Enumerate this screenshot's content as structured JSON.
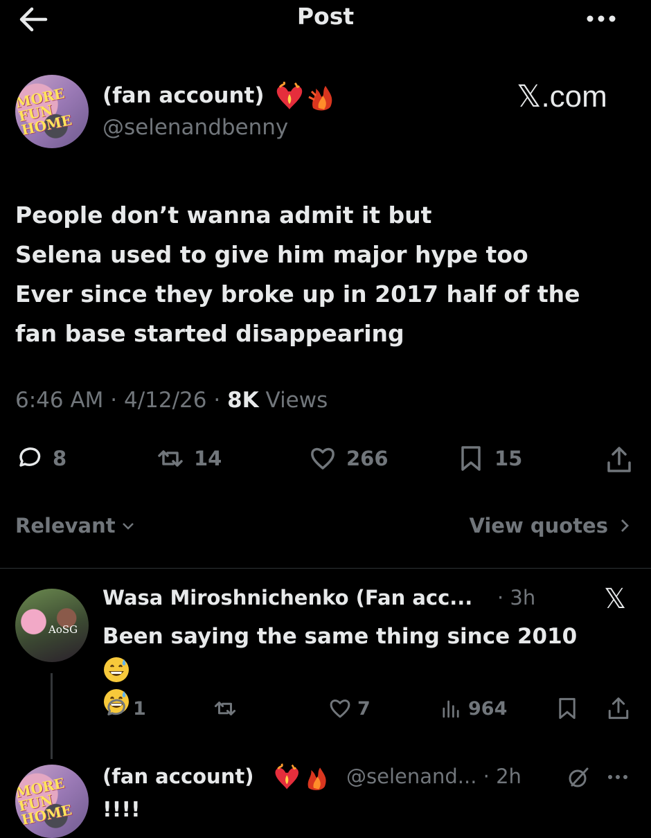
{
  "header": {
    "title": "Post",
    "back_icon": "arrow-left-icon",
    "more_icon": "more-horizontal-icon"
  },
  "post": {
    "author": {
      "display_name": "(fan account)",
      "handle": "@selenandbenny",
      "badge_emojis": "heart-on-fire-icon, fire-icon",
      "avatar_text": "MORE FUN HOME"
    },
    "source_mark": "𝕏.com",
    "text": "People don’t wanna admit it but\n Selena used to give him major hype too\nEver since they broke up in 2017 half of the\nfan base started disappearing",
    "time": "6:46 AM",
    "date": "4/12/26",
    "separator": "·",
    "views_count": "8K",
    "views_label": "Views",
    "actions": {
      "replies": "8",
      "reposts": "14",
      "likes": "266",
      "bookmarks": "15"
    }
  },
  "replies_bar": {
    "sort_label": "Relevant",
    "view_quotes_label": "View quotes"
  },
  "reply": {
    "display_name": "Wasa Miroshnichenko (Fan acc...",
    "time": "· 3h",
    "text": "Been saying the same thing since 2010",
    "emoji": "grinning-face-with-sweat-icon",
    "avatar_text": "AoSG",
    "actions": {
      "replies": "1",
      "reposts": "",
      "likes": "7",
      "views": "964"
    }
  },
  "reply2": {
    "display_name": "(fan account)",
    "handle_time": "@selenand... · 2h",
    "text": "!!!!"
  },
  "colors": {
    "background": "#000000",
    "text_primary": "#e7e9ea",
    "text_secondary": "#71767b",
    "divider": "#2f3336"
  }
}
